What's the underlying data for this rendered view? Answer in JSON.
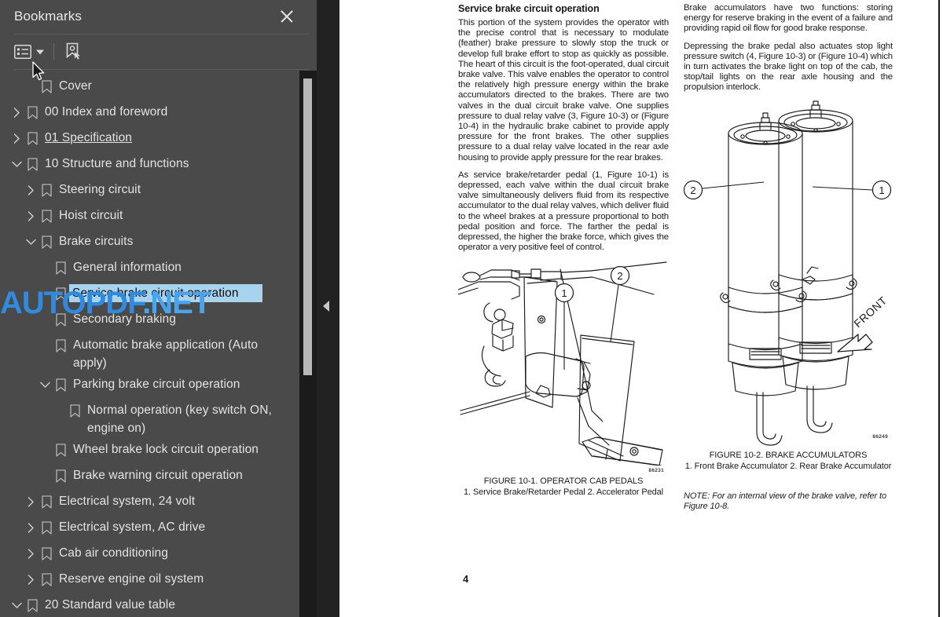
{
  "sidebar": {
    "title": "Bookmarks",
    "close_icon": "close-icon",
    "toolbar": {
      "list_options_label": "list-options",
      "list_options_icon": "list-view-icon",
      "dropdown_icon": "chevron-down-icon",
      "new_bookmark_icon": "new-bookmark-icon"
    },
    "cursor_icon": "mouse-pointer-icon",
    "tree": [
      {
        "label": "Cover",
        "level": 1,
        "state": "leaf",
        "selected": false,
        "link": false
      },
      {
        "label": "00 Index and foreword",
        "level": 0,
        "state": "collapsed",
        "selected": false,
        "link": false
      },
      {
        "label": "01 Specification",
        "level": 0,
        "state": "collapsed",
        "selected": false,
        "link": true
      },
      {
        "label": "10 Structure and functions",
        "level": 0,
        "state": "expanded",
        "selected": false,
        "link": false
      },
      {
        "label": "Steering circuit",
        "level": 1,
        "state": "collapsed",
        "selected": false,
        "link": false
      },
      {
        "label": "Hoist circuit",
        "level": 1,
        "state": "collapsed",
        "selected": false,
        "link": false
      },
      {
        "label": "Brake circuits",
        "level": 1,
        "state": "expanded",
        "selected": false,
        "link": false
      },
      {
        "label": "General information",
        "level": 2,
        "state": "leaf",
        "selected": false,
        "link": false
      },
      {
        "label": "Service brake circuit operation",
        "level": 2,
        "state": "leaf",
        "selected": true,
        "link": false
      },
      {
        "label": "Secondary braking",
        "level": 2,
        "state": "leaf",
        "selected": false,
        "link": false
      },
      {
        "label": "Automatic brake application (Auto apply)",
        "level": 2,
        "state": "leaf",
        "selected": false,
        "link": false
      },
      {
        "label": "Parking brake circuit operation",
        "level": 2,
        "state": "expanded",
        "selected": false,
        "link": false
      },
      {
        "label": "Normal operation (key switch ON, engine on)",
        "level": 3,
        "state": "leaf",
        "selected": false,
        "link": false
      },
      {
        "label": "Wheel brake lock circuit operation",
        "level": 2,
        "state": "leaf",
        "selected": false,
        "link": false
      },
      {
        "label": "Brake warning circuit operation",
        "level": 2,
        "state": "leaf",
        "selected": false,
        "link": false
      },
      {
        "label": "Electrical system, 24 volt",
        "level": 1,
        "state": "collapsed",
        "selected": false,
        "link": false
      },
      {
        "label": "Electrical system, AC drive",
        "level": 1,
        "state": "collapsed",
        "selected": false,
        "link": false
      },
      {
        "label": "Cab air conditioning",
        "level": 1,
        "state": "collapsed",
        "selected": false,
        "link": false
      },
      {
        "label": "Reserve engine oil system",
        "level": 1,
        "state": "collapsed",
        "selected": false,
        "link": false
      },
      {
        "label": "20 Standard value table",
        "level": 0,
        "state": "expanded",
        "selected": false,
        "link": false
      }
    ],
    "colors": {
      "background": "#4a4a4a",
      "text": "#e3e3e3",
      "selection": "#a8d3ec",
      "scrollbar_track": "#1b1b1b",
      "scrollbar_thumb": "#b8b8b8"
    }
  },
  "collapse_handle": {
    "icon": "triangle-left-icon"
  },
  "watermark": {
    "part1": "AUTOPDF",
    "part2": ".NET",
    "color1": "#2f8ae0",
    "color2": "#4ba3ee"
  },
  "document": {
    "page_number": "4",
    "left_column": {
      "heading": "Service brake circuit operation",
      "paragraphs": [
        "This portion of the system provides the operator with the precise control that is necessary to modulate (feather) brake pressure to slowly stop the truck or develop full brake effort to stop as quickly as possible. The heart of this circuit is the foot-operated, dual circuit brake valve. This valve enables the operator to control the relatively high pressure energy within the brake accumulators directed to the brakes. There are two valves in the dual circuit brake valve. One supplies pressure to dual relay valve (3, Figure 10-3) or (Figure 10-4) in the hydraulic brake cabinet to provide apply pressure for the front brakes. The other supplies pressure to a dual relay valve located in the rear axle housing to provide apply pressure for the rear brakes.",
        "As service brake/retarder pedal (1, Figure 10-1) is depressed, each valve within the dual circuit brake valve simultaneously delivers fluid from its respective accumulator to the dual relay valves, which deliver fluid to the wheel brakes at a pressure proportional to both pedal position and force. The farther the pedal is depressed, the higher the brake force, which gives the operator a very positive feel of control."
      ],
      "figure": {
        "drawing_code": "86231",
        "caption": "FIGURE 10-1. OPERATOR CAB PEDALS",
        "items": [
          "1. Service Brake/Retarder Pedal",
          "2. Accelerator Pedal"
        ],
        "callouts": [
          "1",
          "2"
        ]
      }
    },
    "right_column": {
      "paragraphs": [
        "Brake accumulators have two functions: storing energy for reserve braking in the event of a failure and providing rapid oil flow for good brake response.",
        "Depressing the brake pedal also actuates stop light pressure switch (4, Figure 10-3) or (Figure 10-4) which in turn activates the brake light on top of the cab, the stop/tail lights on the rear axle housing and the propulsion interlock."
      ],
      "figure": {
        "drawing_code": "86249",
        "caption": "FIGURE 10-2. BRAKE ACCUMULATORS",
        "items": [
          "1. Front Brake Accumulator",
          "2. Rear Brake Accumulator"
        ],
        "callouts": [
          "1",
          "2"
        ],
        "direction_label": "FRONT"
      },
      "note": "NOTE: For an internal view of the brake valve, refer to Figure 10-8."
    }
  }
}
